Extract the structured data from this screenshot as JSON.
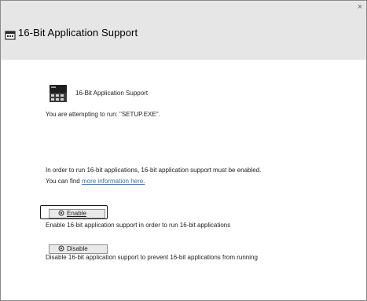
{
  "window": {
    "title": "16-Bit Application Support",
    "close_glyph": "×"
  },
  "content": {
    "heading": "16-Bit Application Support",
    "attempt_line": "You are attempting to run: \"SETUP.EXE\".",
    "requirement_line": "In order to run 16-bit applications, 16-bit application support must be enabled.",
    "info_prefix": "You can find ",
    "info_link": "more information here."
  },
  "enable": {
    "label": "Enable",
    "description": "Enable 16-bit application support in order to run 16-bit applications"
  },
  "disable": {
    "label": "Disable",
    "description": "Disable 16-bit application support to prevent 16-bit applications from running"
  },
  "icons": {
    "title": "app-window-icon",
    "app": "legacy-application-icon",
    "button": "shield-gear-icon"
  },
  "colors": {
    "titlebar": "#e6e6e6",
    "link": "#3b6ea5",
    "focus_ring": "#1a1a1a"
  }
}
